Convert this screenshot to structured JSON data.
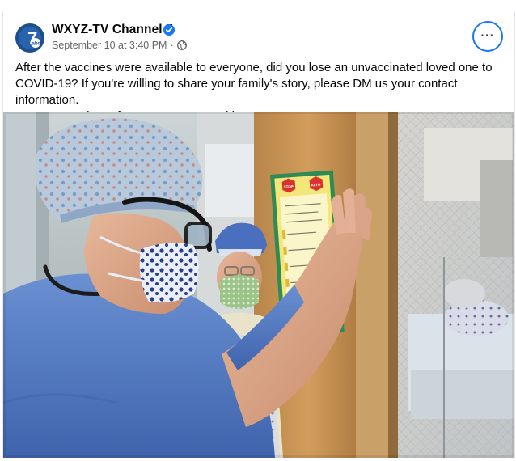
{
  "post": {
    "page_name": "WXYZ-TV Channel 7",
    "verified": true,
    "avatar_text": "7",
    "avatar_sub": "abc",
    "timestamp": "September 10 at 3:40 PM",
    "separator": " · ",
    "audience_icon": "globe-icon",
    "more_icon": "more-options-icon",
    "more_label": "···",
    "text_lines": [
      "After the vaccines were available to everyone, did you lose an unvaccinated loved one to",
      "COVID-19? If you're willing to share your family's story, please DM us your contact information.",
      "We may reach out for a story we're working on."
    ],
    "sign_stop_left": "STOP",
    "sign_stop_right": "ALTO"
  },
  "colors": {
    "brand_blue": "#1877f2",
    "text_primary": "#050505",
    "text_secondary": "#65676b",
    "scrubs_blue": "#4f78c4",
    "stop_red": "#d9342b"
  }
}
